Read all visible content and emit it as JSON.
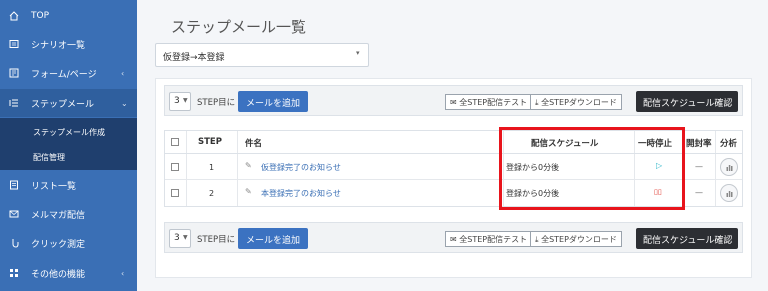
{
  "sidebar": {
    "items": [
      {
        "label": "TOP",
        "icon": "home-icon"
      },
      {
        "label": "シナリオ一覧",
        "icon": "list-icon"
      },
      {
        "label": "フォーム/ページ",
        "icon": "form-icon"
      },
      {
        "label": "ステップメール",
        "icon": "step-list-icon"
      },
      {
        "label": "リスト一覧",
        "icon": "document-icon"
      },
      {
        "label": "メルマガ配信",
        "icon": "mail-icon"
      },
      {
        "label": "クリック測定",
        "icon": "pointer-icon"
      },
      {
        "label": "その他の機能",
        "icon": "grid-icon"
      }
    ],
    "chevron": "‹",
    "subitems": [
      "ステップメール作成",
      "配信管理"
    ]
  },
  "main": {
    "title": "ステップメール一覧",
    "select_value": "仮登録→本登録",
    "select_caret": "▾",
    "toolbar": {
      "step_count": "3",
      "step_suffix": "STEP目に",
      "add_mail": "メールを追加",
      "test_all": "✉ 全STEP配信テスト",
      "download_all": "⤓ 全STEPダウンロード",
      "schedule_confirm": "配信スケジュール確認"
    },
    "table": {
      "headers": [
        "STEP",
        "件名",
        "配信スケジュール",
        "一時停止",
        "開封率",
        "分析"
      ],
      "rows": [
        {
          "step": "1",
          "subject": "仮登録完了のお知らせ",
          "schedule": "登録から0分後",
          "pause": "▷",
          "open_rate": "—"
        },
        {
          "step": "2",
          "subject": "本登録完了のお知らせ",
          "schedule": "登録から0分後",
          "pause": "▯▯",
          "open_rate": "—"
        }
      ]
    }
  },
  "colors": {
    "sidebar": "#3a6fb5",
    "sidebar_sub": "#1f3f6e",
    "primary_button": "#3b72c1",
    "dark_button": "#2c2e33",
    "highlight": "#e8141c",
    "play": "#2bb5c8",
    "pause": "#e0382f"
  }
}
